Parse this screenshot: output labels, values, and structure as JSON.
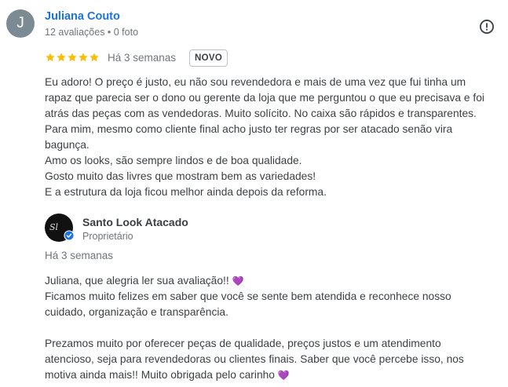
{
  "review": {
    "avatar_letter": "J",
    "avatar_color": "#7b8a93",
    "author": "Juliana Couto",
    "meta": "12 avaliações • 0 foto",
    "rating": 5,
    "star_color": "#fbbc04",
    "date": "Há 3 semanas",
    "badge": "NOVO",
    "lines": [
      "Eu adoro! O preço é justo, eu não sou revendedora e mais de uma vez que fui tinha um",
      "rapaz que parecia ser o dono ou gerente da loja que me perguntou o que eu precisava e foi",
      "atrás das peças com as vendedoras. Muito solícito. No caixa são rápidos e transparentes.",
      "Para mim, mesmo como cliente final acho justo ter regras por ser atacado senão vira",
      "bagunça.",
      "Amo os looks, são sempre lindos e de boa qualidade.",
      "Gosto muito das livres que mostram bem as variedades!",
      "E a estrutura da loja ficou melhor ainda depois da reforma."
    ]
  },
  "owner_reply": {
    "name": "Santo Look Atacado",
    "role": "Proprietário",
    "date": "Há 3 semanas",
    "verified_color": "#1a73e8",
    "lines": [
      "Juliana, que alegria ler sua avaliação!! ",
      "Ficamos muito felizes em saber que você se sente bem atendida e reconhece nosso",
      "cuidado, organização e transparência.",
      "",
      "Prezamos muito por oferecer peças de qualidade, preços justos e um atendimento",
      "atencioso, seja para revendedoras ou clientes finais. Saber que você percebe isso, nos",
      "motiva ainda mais!! Muito obrigada pelo carinho "
    ],
    "heart": "💜"
  },
  "icons": {
    "report": "report-flag-icon",
    "verified": "verified-badge-icon",
    "star": "star-icon"
  }
}
